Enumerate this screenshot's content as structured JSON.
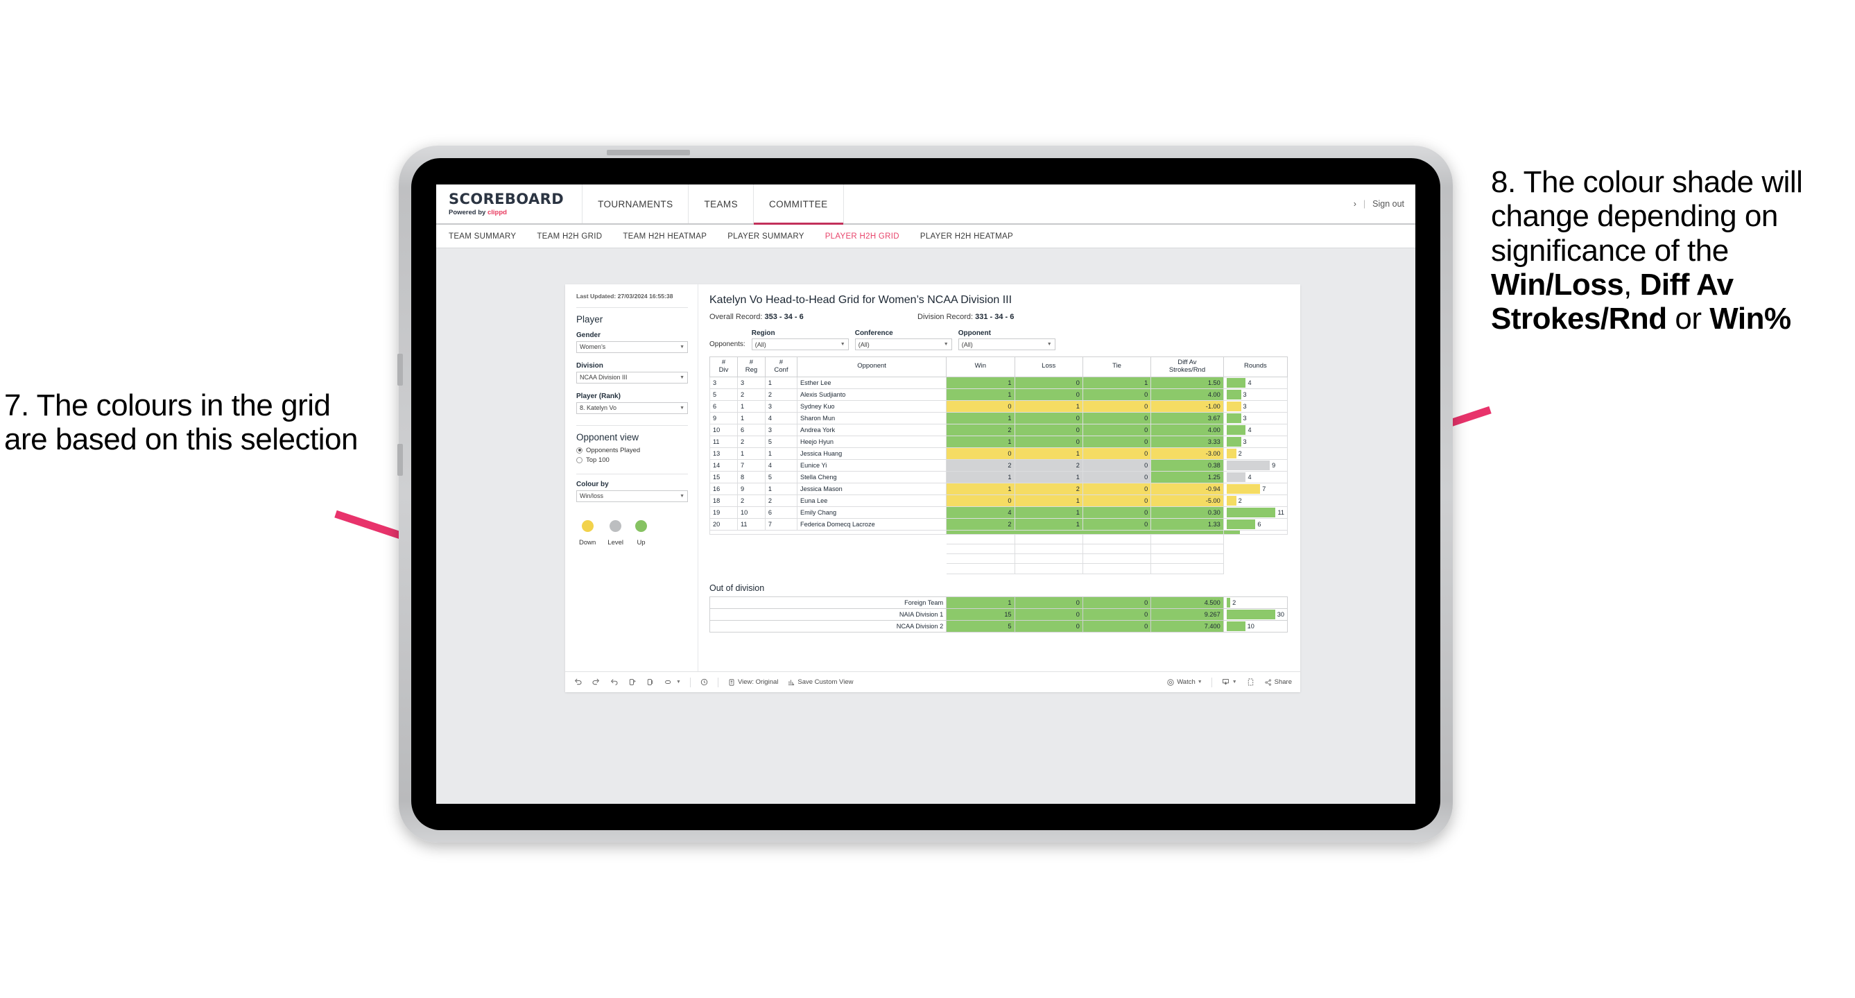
{
  "annotations": {
    "left": {
      "name": "callout-7",
      "text": "7. The colours in the grid are based on this selection"
    },
    "right": {
      "name": "callout-8",
      "pre": "8. The colour shade will change depending on significance of the ",
      "bold1": "Win/Loss",
      "mid1": ", ",
      "bold2": "Diff Av Strokes/Rnd",
      "mid2": " or ",
      "bold3": "Win%",
      "arrow_color": "#e8336b"
    }
  },
  "app": {
    "brand": {
      "title": "SCOREBOARD",
      "powered_prefix": "Powered by ",
      "powered_brand": "clippd"
    },
    "top_nav": [
      {
        "label": "TOURNAMENTS",
        "active": false
      },
      {
        "label": "TEAMS",
        "active": false
      },
      {
        "label": "COMMITTEE",
        "active": true
      }
    ],
    "top_right": {
      "chevron": "›",
      "separator": "|",
      "sign_out": "Sign out"
    },
    "sub_nav": [
      {
        "label": "TEAM SUMMARY",
        "active": false
      },
      {
        "label": "TEAM H2H GRID",
        "active": false
      },
      {
        "label": "TEAM H2H HEATMAP",
        "active": false
      },
      {
        "label": "PLAYER SUMMARY",
        "active": false
      },
      {
        "label": "PLAYER H2H GRID",
        "active": true
      },
      {
        "label": "PLAYER H2H HEATMAP",
        "active": false
      }
    ],
    "accent_color": "#e8446b"
  },
  "sidebar": {
    "last_updated": "Last Updated: 27/03/2024 16:55:38",
    "player_heading": "Player",
    "fields": [
      {
        "label": "Gender",
        "value": "Women’s"
      },
      {
        "label": "Division",
        "value": "NCAA Division III"
      },
      {
        "label": "Player (Rank)",
        "value": "8. Katelyn Vo"
      }
    ],
    "opponent_view": {
      "heading": "Opponent view",
      "options": [
        {
          "label": "Opponents Played",
          "selected": true
        },
        {
          "label": "Top 100",
          "selected": false
        }
      ]
    },
    "colour_by": {
      "label": "Colour by",
      "value": "Win/loss"
    },
    "legend": [
      {
        "label": "Down",
        "color": "#f2d24b"
      },
      {
        "label": "Level",
        "color": "#bcbec0"
      },
      {
        "label": "Up",
        "color": "#86c262"
      }
    ]
  },
  "report": {
    "title": "Katelyn Vo Head-to-Head Grid for Women’s NCAA Division III",
    "overall_record_label": "Overall Record: ",
    "overall_record_value": "353 -  34 - 6",
    "division_record_label": "Division Record: ",
    "division_record_value": "331 -  34 - 6",
    "opponents_label": "Opponents:",
    "filters": [
      {
        "label": "Region",
        "value": "(All)"
      },
      {
        "label": "Conference",
        "value": "(All)"
      },
      {
        "label": "Opponent",
        "value": "(All)"
      }
    ],
    "columns": [
      "# Div",
      "# Reg",
      "# Conf",
      "Opponent",
      "Win",
      "Loss",
      "Tie",
      "Diff Av Strokes/Rnd",
      "Rounds"
    ],
    "column_lines": [
      [
        "#",
        "Div"
      ],
      [
        "#",
        "Reg"
      ],
      [
        "#",
        "Conf"
      ],
      [
        "Opponent"
      ],
      [
        "Win"
      ],
      [
        "Loss"
      ],
      [
        "Tie"
      ],
      [
        "Diff Av",
        "Strokes/Rnd"
      ],
      [
        "Rounds"
      ]
    ],
    "rows": [
      {
        "div": "3",
        "reg": "3",
        "conf": "1",
        "opponent": "Esther Lee",
        "win": "1",
        "loss": "0",
        "tie": "1",
        "diff": "1.50",
        "rounds": "4",
        "color": "#8cc96a",
        "diff_color": "#8cc96a"
      },
      {
        "div": "5",
        "reg": "2",
        "conf": "2",
        "opponent": "Alexis Sudjianto",
        "win": "1",
        "loss": "0",
        "tie": "0",
        "diff": "4.00",
        "rounds": "3",
        "color": "#8cc96a",
        "diff_color": "#8cc96a"
      },
      {
        "div": "6",
        "reg": "1",
        "conf": "3",
        "opponent": "Sydney Kuo",
        "win": "0",
        "loss": "1",
        "tie": "0",
        "diff": "-1.00",
        "rounds": "3",
        "color": "#f5dc63",
        "diff_color": "#f5dc63"
      },
      {
        "div": "9",
        "reg": "1",
        "conf": "4",
        "opponent": "Sharon Mun",
        "win": "1",
        "loss": "0",
        "tie": "0",
        "diff": "3.67",
        "rounds": "3",
        "color": "#8cc96a",
        "diff_color": "#8cc96a"
      },
      {
        "div": "10",
        "reg": "6",
        "conf": "3",
        "opponent": "Andrea York",
        "win": "2",
        "loss": "0",
        "tie": "0",
        "diff": "4.00",
        "rounds": "4",
        "color": "#8cc96a",
        "diff_color": "#8cc96a"
      },
      {
        "div": "11",
        "reg": "2",
        "conf": "5",
        "opponent": "Heejo Hyun",
        "win": "1",
        "loss": "0",
        "tie": "0",
        "diff": "3.33",
        "rounds": "3",
        "color": "#8cc96a",
        "diff_color": "#8cc96a"
      },
      {
        "div": "13",
        "reg": "1",
        "conf": "1",
        "opponent": "Jessica Huang",
        "win": "0",
        "loss": "1",
        "tie": "0",
        "diff": "-3.00",
        "rounds": "2",
        "color": "#f5dc63",
        "diff_color": "#f5dc63"
      },
      {
        "div": "14",
        "reg": "7",
        "conf": "4",
        "opponent": "Eunice Yi",
        "win": "2",
        "loss": "2",
        "tie": "0",
        "diff": "0.38",
        "rounds": "9",
        "color": "#d2d3d5",
        "diff_color": "#8cc96a"
      },
      {
        "div": "15",
        "reg": "8",
        "conf": "5",
        "opponent": "Stella Cheng",
        "win": "1",
        "loss": "1",
        "tie": "0",
        "diff": "1.25",
        "rounds": "4",
        "color": "#d2d3d5",
        "diff_color": "#8cc96a"
      },
      {
        "div": "16",
        "reg": "9",
        "conf": "1",
        "opponent": "Jessica Mason",
        "win": "1",
        "loss": "2",
        "tie": "0",
        "diff": "-0.94",
        "rounds": "7",
        "color": "#f5dc63",
        "diff_color": "#f5dc63"
      },
      {
        "div": "18",
        "reg": "2",
        "conf": "2",
        "opponent": "Euna Lee",
        "win": "0",
        "loss": "1",
        "tie": "0",
        "diff": "-5.00",
        "rounds": "2",
        "color": "#f5dc63",
        "diff_color": "#f5dc63"
      },
      {
        "div": "19",
        "reg": "10",
        "conf": "6",
        "opponent": "Emily Chang",
        "win": "4",
        "loss": "1",
        "tie": "0",
        "diff": "0.30",
        "rounds": "11",
        "color": "#8cc96a",
        "diff_color": "#8cc96a"
      },
      {
        "div": "20",
        "reg": "11",
        "conf": "7",
        "opponent": "Federica Domecq Lacroze",
        "win": "2",
        "loss": "1",
        "tie": "0",
        "diff": "1.33",
        "rounds": "6",
        "color": "#8cc96a",
        "diff_color": "#8cc96a"
      }
    ],
    "rounds_max": 12,
    "out_of_division": {
      "title": "Out of division",
      "rows": [
        {
          "name": "Foreign Team",
          "win": "1",
          "loss": "0",
          "tie": "0",
          "diff": "4.500",
          "rounds": "2",
          "color": "#8cc96a"
        },
        {
          "name": "NAIA Division 1",
          "win": "15",
          "loss": "0",
          "tie": "0",
          "diff": "9.267",
          "rounds": "30",
          "color": "#8cc96a"
        },
        {
          "name": "NCAA Division 2",
          "win": "5",
          "loss": "0",
          "tie": "0",
          "diff": "7.400",
          "rounds": "10",
          "color": "#8cc96a"
        }
      ],
      "rounds_max": 31
    }
  },
  "toolbar": {
    "view_label": "View: Original",
    "save_label": "Save Custom View",
    "watch_label": "Watch",
    "share_label": "Share",
    "caret": "▾"
  },
  "chart_data": {
    "type": "table",
    "title": "Katelyn Vo Head-to-Head Grid for Women’s NCAA Division III",
    "columns": [
      "# Div",
      "# Reg",
      "# Conf",
      "Opponent",
      "Win",
      "Loss",
      "Tie",
      "Diff Av Strokes/Rnd",
      "Rounds"
    ],
    "values": [
      [
        3,
        3,
        1,
        "Esther Lee",
        1,
        0,
        1,
        1.5,
        4
      ],
      [
        5,
        2,
        2,
        "Alexis Sudjianto",
        1,
        0,
        0,
        4.0,
        3
      ],
      [
        6,
        1,
        3,
        "Sydney Kuo",
        0,
        1,
        0,
        -1.0,
        3
      ],
      [
        9,
        1,
        4,
        "Sharon Mun",
        1,
        0,
        0,
        3.67,
        3
      ],
      [
        10,
        6,
        3,
        "Andrea York",
        2,
        0,
        0,
        4.0,
        4
      ],
      [
        11,
        2,
        5,
        "Heejo Hyun",
        1,
        0,
        0,
        3.33,
        3
      ],
      [
        13,
        1,
        1,
        "Jessica Huang",
        0,
        1,
        0,
        -3.0,
        2
      ],
      [
        14,
        7,
        4,
        "Eunice Yi",
        2,
        2,
        0,
        0.38,
        9
      ],
      [
        15,
        8,
        5,
        "Stella Cheng",
        1,
        1,
        0,
        1.25,
        4
      ],
      [
        16,
        9,
        1,
        "Jessica Mason",
        1,
        2,
        0,
        -0.94,
        7
      ],
      [
        18,
        2,
        2,
        "Euna Lee",
        0,
        1,
        0,
        -5.0,
        2
      ],
      [
        19,
        10,
        6,
        "Emily Chang",
        4,
        1,
        0,
        0.3,
        11
      ],
      [
        20,
        11,
        7,
        "Federica Domecq Lacroze",
        2,
        1,
        0,
        1.33,
        6
      ]
    ],
    "out_of_division_values": [
      [
        "Foreign Team",
        1,
        0,
        0,
        4.5,
        2
      ],
      [
        "NAIA Division 1",
        15,
        0,
        0,
        9.267,
        30
      ],
      [
        "NCAA Division 2",
        5,
        0,
        0,
        7.4,
        10
      ]
    ],
    "colour_by": "Win/loss",
    "legend": [
      "Down",
      "Level",
      "Up"
    ],
    "legend_colors": [
      "#f2d24b",
      "#bcbec0",
      "#86c262"
    ]
  }
}
